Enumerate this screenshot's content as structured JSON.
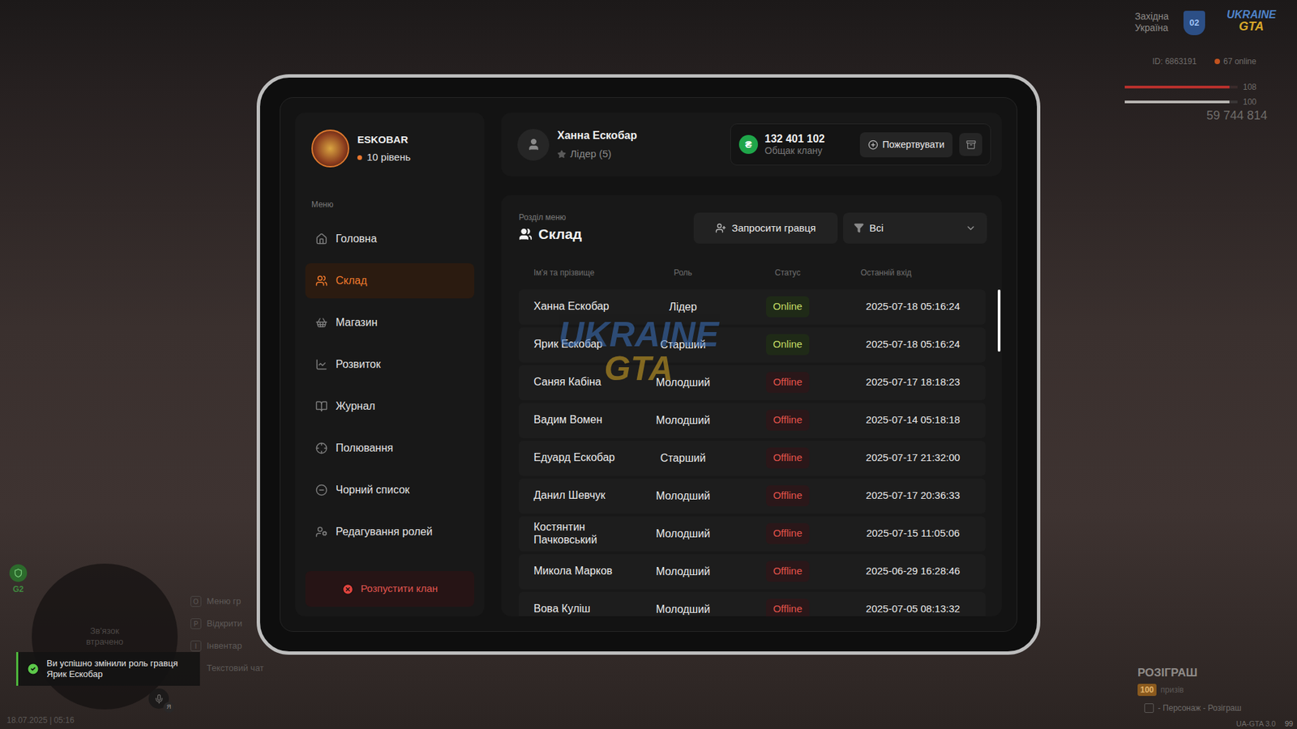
{
  "hud": {
    "region": [
      "Західна",
      "Україна"
    ],
    "region_badge": "02",
    "logo": {
      "top": "UKRAINE",
      "bottom": "GTA"
    },
    "player_id": "ID: 6863191",
    "online": "67 online",
    "health": {
      "level": 0.93,
      "reading": "108"
    },
    "armor": {
      "level": 0.93,
      "reading": "100"
    },
    "money": "59 744 814",
    "minimap": {
      "badge": "G2",
      "no_signal": "Зв'язок втрачено",
      "voice_key": "Я"
    },
    "hints": [
      {
        "key": "O",
        "label": "Меню гр"
      },
      {
        "key": "P",
        "label": "Відкрити"
      },
      {
        "key": "I",
        "label": "Інвентар"
      },
      {
        "label": "Текстовий чат"
      }
    ],
    "notification": "Ви успішно змінили роль гравця Ярик Ескобар",
    "datetime": "18.07.2025 | 05:16",
    "giveaway": {
      "title": "РОЗІГРАШ",
      "count": "100",
      "caption": "призів",
      "hint": "- Персонаж - Розіграш"
    },
    "version": "UA-GTA 3.0",
    "fps": "99"
  },
  "clan": {
    "name": "ESKOBAR",
    "level": "10 рівень"
  },
  "sidebar": {
    "label": "Меню",
    "items": [
      {
        "label": "Головна",
        "selected": false
      },
      {
        "label": "Склад",
        "selected": true
      },
      {
        "label": "Магазин",
        "selected": false
      },
      {
        "label": "Розвиток",
        "selected": false
      },
      {
        "label": "Журнал",
        "selected": false
      },
      {
        "label": "Полювання",
        "selected": false
      },
      {
        "label": "Чорний список",
        "selected": false
      },
      {
        "label": "Редагування ролей",
        "selected": false
      }
    ],
    "disband_button": "Розпустити клан"
  },
  "user": {
    "name": "Ханна Ескобар",
    "role": "Лідер (5)"
  },
  "treasury": {
    "currency": "₴",
    "amount": "132 401 102",
    "label": "Общак клану",
    "donate_button": "Пожертвувати"
  },
  "section": {
    "caption": "Розділ меню",
    "title": "Склад",
    "invite_button": "Запросити гравця",
    "filter": "Всі"
  },
  "watermark": {
    "top": "UKRAINE",
    "bottom": "GTA"
  },
  "table": {
    "columns": [
      "Ім'я та прізвище",
      "Роль",
      "Статус",
      "Останній вхід"
    ],
    "rows": [
      {
        "name": "Ханна Ескобар",
        "role": "Лідер",
        "status": "Online",
        "online": true,
        "last_login": "2025-07-18 05:16:24"
      },
      {
        "name": "Ярик Ескобар",
        "role": "Старший",
        "status": "Online",
        "online": true,
        "last_login": "2025-07-18 05:16:24"
      },
      {
        "name": "Саняя Кабіна",
        "role": "Молодший",
        "status": "Offline",
        "online": false,
        "last_login": "2025-07-17 18:18:23"
      },
      {
        "name": "Вадим Вомен",
        "role": "Молодший",
        "status": "Offline",
        "online": false,
        "last_login": "2025-07-14 05:18:18"
      },
      {
        "name": "Едуард Ескобар",
        "role": "Старший",
        "status": "Offline",
        "online": false,
        "last_login": "2025-07-17 21:32:00"
      },
      {
        "name": "Данил Шевчук",
        "role": "Молодший",
        "status": "Offline",
        "online": false,
        "last_login": "2025-07-17 20:36:33"
      },
      {
        "name": "Костянтин Пачковський",
        "role": "Молодший",
        "status": "Offline",
        "online": false,
        "last_login": "2025-07-15 11:05:06"
      },
      {
        "name": "Микола Марков",
        "role": "Молодший",
        "status": "Offline",
        "online": false,
        "last_login": "2025-06-29 16:28:46"
      },
      {
        "name": "Вова Куліш",
        "role": "Молодший",
        "status": "Offline",
        "online": false,
        "last_login": "2025-07-05 08:13:32"
      }
    ]
  }
}
